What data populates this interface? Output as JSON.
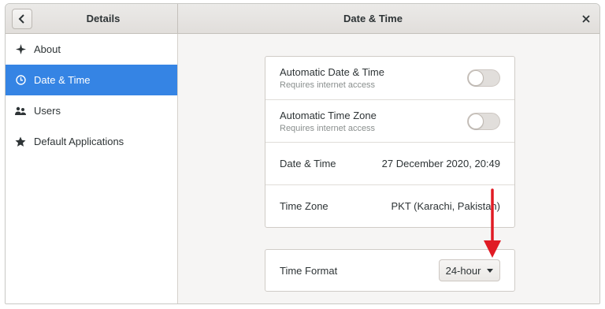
{
  "header": {
    "sidebar_title": "Details",
    "main_title": "Date & Time"
  },
  "sidebar": {
    "items": [
      {
        "label": "About",
        "icon": "star-sparkle-icon",
        "active": false
      },
      {
        "label": "Date & Time",
        "icon": "clock-icon",
        "active": true
      },
      {
        "label": "Users",
        "icon": "users-icon",
        "active": false
      },
      {
        "label": "Default Applications",
        "icon": "star-icon",
        "active": false
      }
    ]
  },
  "settings": {
    "auto_date_time": {
      "title": "Automatic Date & Time",
      "subtitle": "Requires internet access",
      "enabled": false
    },
    "auto_time_zone": {
      "title": "Automatic Time Zone",
      "subtitle": "Requires internet access",
      "enabled": false
    },
    "date_time": {
      "label": "Date & Time",
      "value": "27 December 2020, 20:49"
    },
    "time_zone": {
      "label": "Time Zone",
      "value": "PKT (Karachi, Pakistan)"
    },
    "time_format": {
      "label": "Time Format",
      "value": "24-hour"
    }
  },
  "colors": {
    "accent": "#3584e4",
    "annotation_arrow": "#e01b24"
  }
}
